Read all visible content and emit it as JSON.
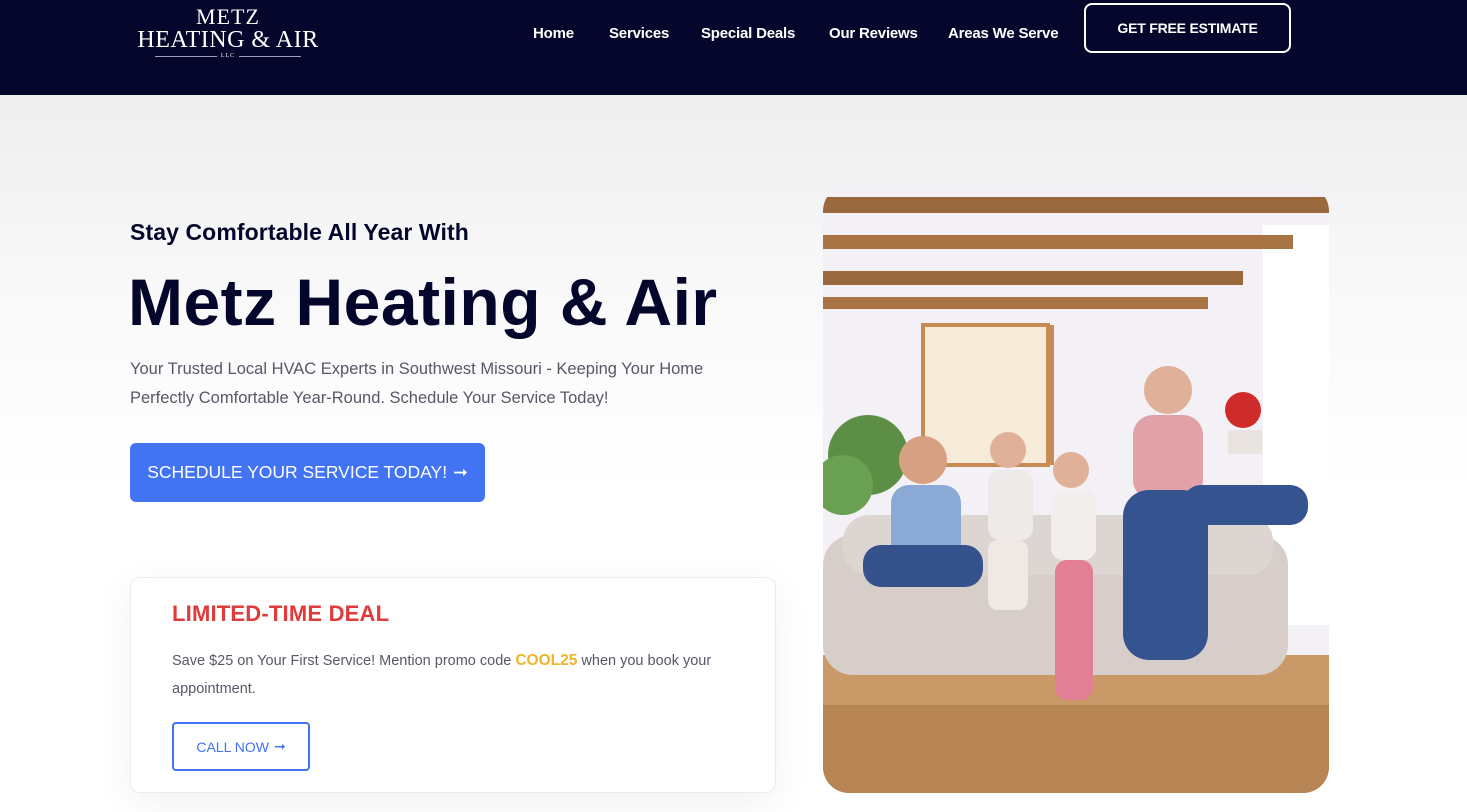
{
  "header": {
    "logo": {
      "line1": "METZ",
      "line2": "HEATING & AIR",
      "llc": "LLC"
    },
    "nav": [
      {
        "label": "Home"
      },
      {
        "label": "Services"
      },
      {
        "label": "Special Deals"
      },
      {
        "label": "Our Reviews"
      },
      {
        "label": "Areas We Serve"
      }
    ],
    "estimate_button": "GET FREE ESTIMATE"
  },
  "hero": {
    "pre_title": "Stay Comfortable All Year With",
    "title": "Metz Heating & Air",
    "subtitle": "Your Trusted Local HVAC Experts in Southwest Missouri - Keeping Your Home Perfectly Comfortable Year-Round. Schedule Your Service Today!",
    "cta_label": "SCHEDULE YOUR SERVICE TODAY!",
    "cta_icon": "arrow-right-icon",
    "image_icon": "family-living-room-photo"
  },
  "deal": {
    "title": "LIMITED-TIME DEAL",
    "text_before": "Save $25 on Your First Service! Mention promo code ",
    "promo_code": "COOL25",
    "text_after": " when you book your appointment.",
    "button_label": "CALL NOW",
    "button_icon": "arrow-right-icon"
  },
  "colors": {
    "header_bg": "#04072b",
    "primary_blue": "#4173f3",
    "deal_red": "#e03b3b",
    "promo_yellow": "#f0b429",
    "heading_navy": "#04072b"
  }
}
